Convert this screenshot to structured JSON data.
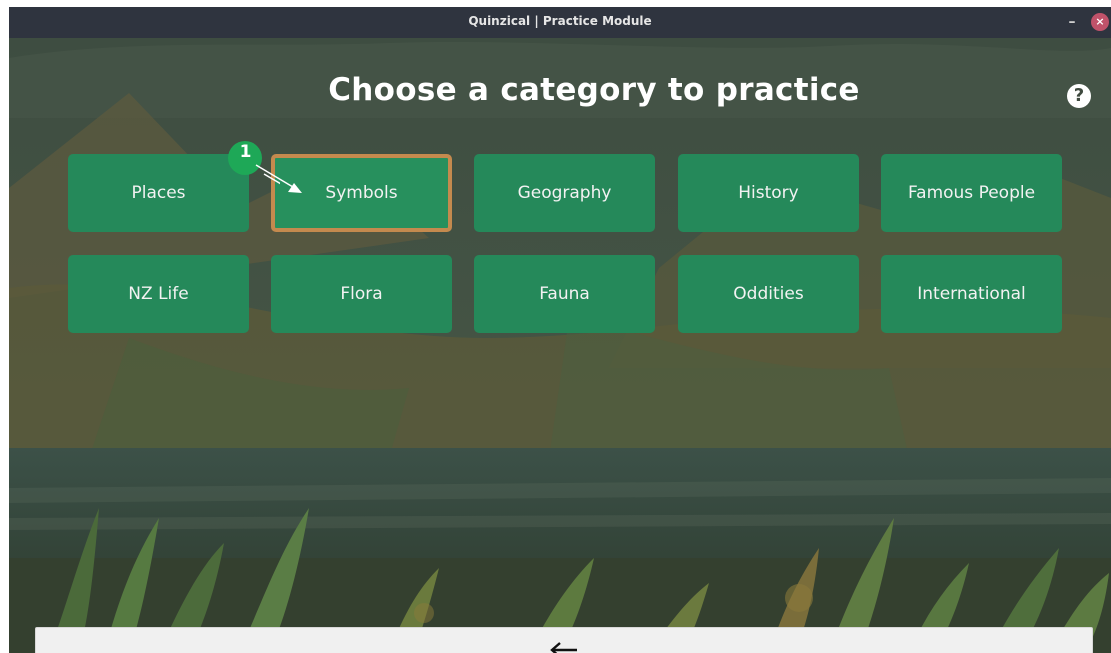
{
  "window": {
    "title": "Quinzical | Practice Module",
    "minimize_label": "–",
    "close_label": "×"
  },
  "page": {
    "heading": "Choose a category to practice",
    "help_label": "?"
  },
  "categories": [
    {
      "label": "Places",
      "selected": false
    },
    {
      "label": "Symbols",
      "selected": true
    },
    {
      "label": "Geography",
      "selected": false
    },
    {
      "label": "History",
      "selected": false
    },
    {
      "label": "Famous People",
      "selected": false
    },
    {
      "label": "NZ Life",
      "selected": false
    },
    {
      "label": "Flora",
      "selected": false
    },
    {
      "label": "Fauna",
      "selected": false
    },
    {
      "label": "Oddities",
      "selected": false
    },
    {
      "label": "International",
      "selected": false
    }
  ],
  "annotation": {
    "step_label": "1",
    "color": "#1ea857"
  },
  "colors": {
    "category_button": "#25895a",
    "selected_border": "#c48a4e",
    "titlebar": "#2f343f"
  },
  "icons": {
    "help": "question-circle-icon",
    "back": "arrow-left-icon",
    "close": "close-icon",
    "minimize": "minimize-icon"
  }
}
